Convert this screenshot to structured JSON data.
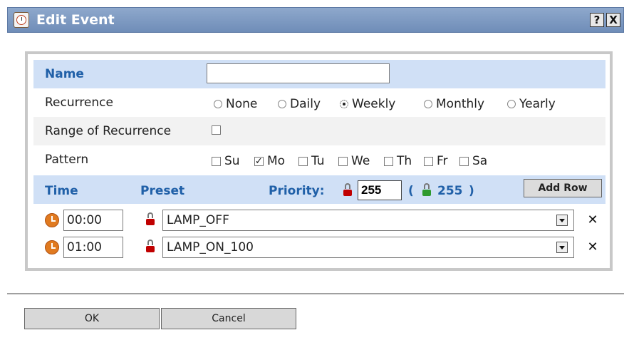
{
  "window": {
    "title": "Edit Event",
    "help_label": "?",
    "close_label": "X"
  },
  "form": {
    "name_label": "Name",
    "name_value": "",
    "recurrence_label": "Recurrence",
    "recurrence_options": [
      "None",
      "Daily",
      "Weekly",
      "Monthly",
      "Yearly"
    ],
    "recurrence_selected": "Weekly",
    "range_label": "Range of Recurrence",
    "range_checked": false,
    "pattern_label": "Pattern",
    "pattern_days": [
      "Su",
      "Mo",
      "Tu",
      "We",
      "Th",
      "Fr",
      "Sa"
    ],
    "pattern_checked": [
      "Mo"
    ]
  },
  "schedule": {
    "time_header": "Time",
    "preset_header": "Preset",
    "priority_label": "Priority:",
    "priority_value": "255",
    "priority_paren_open": "(",
    "priority_default": "255",
    "priority_paren_close": ")",
    "add_row_label": "Add Row",
    "rows": [
      {
        "time": "00:00",
        "preset": "LAMP_OFF"
      },
      {
        "time": "01:00",
        "preset": "LAMP_ON_100"
      }
    ]
  },
  "footer": {
    "ok_label": "OK",
    "cancel_label": "Cancel"
  },
  "icons": [
    "clock-icon",
    "help-icon",
    "close-icon",
    "priority-chip-icon",
    "dropdown-arrow-icon",
    "delete-row-icon"
  ],
  "colors": {
    "titlebar": "#7b97c0",
    "header_band": "#d0e0f6",
    "header_text": "#2060a8",
    "clock": "#e07a20",
    "chip_red": "#c00000",
    "chip_green": "#2e9a2e"
  }
}
